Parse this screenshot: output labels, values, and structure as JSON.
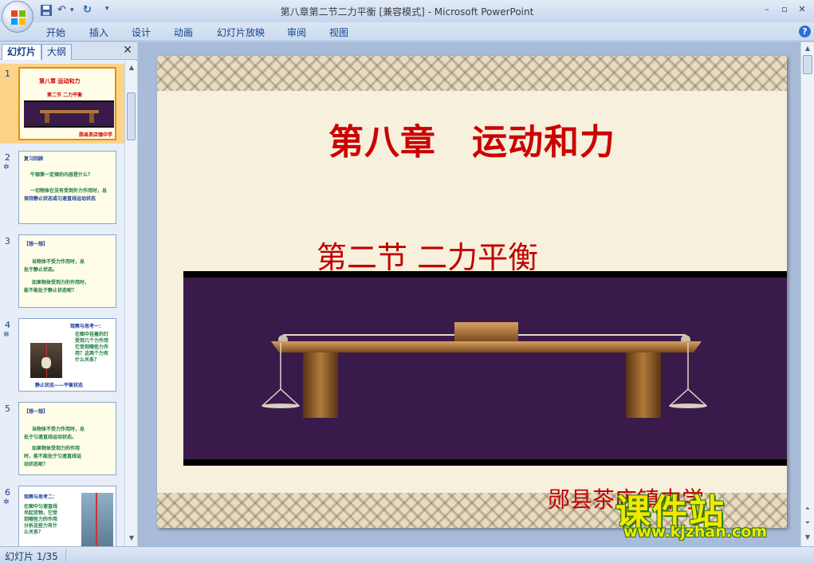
{
  "window": {
    "title": "第八章第二节二力平衡 [兼容模式] - Microsoft PowerPoint",
    "minimize": "–",
    "restore": "▫",
    "close": "✕"
  },
  "quick_access": {
    "save_icon": "save-icon",
    "undo_icon": "undo-icon",
    "redo_icon": "redo-icon",
    "customize_icon": "customize-icon"
  },
  "ribbon": {
    "tabs": [
      "开始",
      "插入",
      "设计",
      "动画",
      "幻灯片放映",
      "审阅",
      "视图"
    ],
    "help": "?"
  },
  "left_panel": {
    "tabs": [
      "幻灯片",
      "大纲"
    ],
    "close": "✕"
  },
  "thumbnails": [
    {
      "num": "1",
      "lines": [
        "第八章  运动和力",
        "第二节 二力平衡"
      ],
      "footer": "郧县茶店镇中学"
    },
    {
      "num": "2",
      "star": "✲",
      "lines": [
        "复习回顾",
        "牛顿第一定律的内容是什么？",
        "一切物体在没有受到外力作用时，总",
        "保持静止状态或匀速直线运动状态"
      ]
    },
    {
      "num": "3",
      "lines": [
        "【想一想】",
        "当物体不受力作用时，总",
        "处于静止状态。",
        "如果物体受到力的作用时，",
        "能不能处于静止状态呢？"
      ]
    },
    {
      "num": "4",
      "star": "✲",
      "lines": [
        "观察与思考一：",
        "在图中挂着的灯",
        "受到几个力作用",
        "它受到哪些力作",
        "用？这两个力有",
        "什么关系？"
      ],
      "footer": "静止状态——平衡状态"
    },
    {
      "num": "5",
      "lines": [
        "【想一想】",
        "当物体不受力作用时，总",
        "处于匀速直线运动状态。",
        "如果物体受到力的作用",
        "时，能不能处于匀速直线运",
        "动状态呢？"
      ]
    },
    {
      "num": "6",
      "star": "✲",
      "lines": [
        "观察与思考二：",
        "在图中匀速直线",
        "吊起货物，它受",
        "到哪些力的作用",
        "分析这些力有什",
        "么关系？"
      ]
    }
  ],
  "slide": {
    "title": "第八章　运动和力",
    "subtitle": "第二节 二力平衡",
    "author": "郧县茶店镇中学"
  },
  "watermark": {
    "main": "课件站",
    "url": "www.kjzhan.com"
  },
  "status": {
    "slide_indicator": "幻灯片 1/35"
  },
  "colors": {
    "title_red": "#cc0000",
    "slide_bg": "#f7f0dc",
    "image_bg": "#3a1a4a",
    "selected_thumb": "#fbd48a"
  }
}
